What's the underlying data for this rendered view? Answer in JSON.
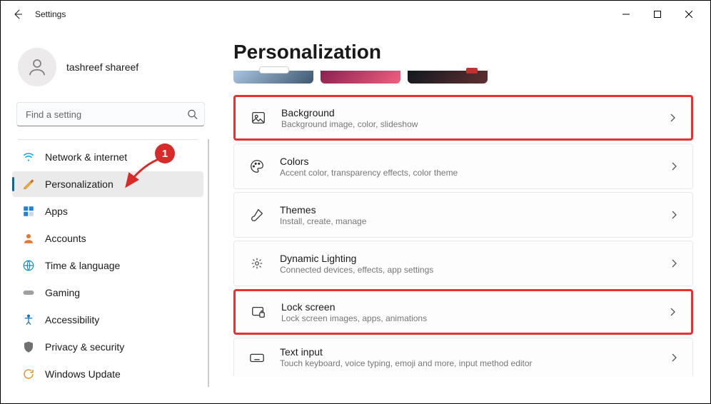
{
  "window": {
    "title": "Settings"
  },
  "user": {
    "name": "tashreef shareef"
  },
  "search": {
    "placeholder": "Find a setting"
  },
  "nav": [
    {
      "label": "Network & internet"
    },
    {
      "label": "Personalization"
    },
    {
      "label": "Apps"
    },
    {
      "label": "Accounts"
    },
    {
      "label": "Time & language"
    },
    {
      "label": "Gaming"
    },
    {
      "label": "Accessibility"
    },
    {
      "label": "Privacy & security"
    },
    {
      "label": "Windows Update"
    }
  ],
  "page": {
    "title": "Personalization"
  },
  "cards": [
    {
      "title": "Background",
      "sub": "Background image, color, slideshow"
    },
    {
      "title": "Colors",
      "sub": "Accent color, transparency effects, color theme"
    },
    {
      "title": "Themes",
      "sub": "Install, create, manage"
    },
    {
      "title": "Dynamic Lighting",
      "sub": "Connected devices, effects, app settings"
    },
    {
      "title": "Lock screen",
      "sub": "Lock screen images, apps, animations"
    },
    {
      "title": "Text input",
      "sub": "Touch keyboard, voice typing, emoji and more, input method editor"
    }
  ],
  "annotation": {
    "badge": "1"
  }
}
